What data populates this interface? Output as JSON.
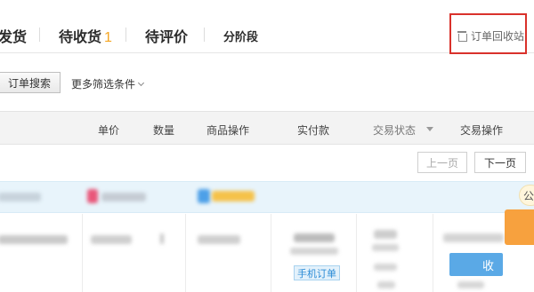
{
  "tabs": {
    "to_ship": "发货",
    "to_receive": "待收货",
    "to_receive_count": "1",
    "to_review": "待评价",
    "installment": "分阶段",
    "recycle_bin": "订单回收站"
  },
  "search": {
    "button_label": "订单搜索",
    "more_filters_label": "更多筛选条件"
  },
  "table": {
    "columns": {
      "unit_price": "单价",
      "quantity": "数量",
      "item_ops": "商品操作",
      "paid": "实付款",
      "trade_status": "交易状态",
      "trade_ops": "交易操作"
    }
  },
  "pager": {
    "prev": "上一页",
    "next": "下一页"
  },
  "order": {
    "side_badge": "公",
    "phone_tag": "手机订单",
    "receive_button": "收"
  },
  "colors": {
    "highlight_box": "#d9312b",
    "count_accent": "#f5a623",
    "order_head_bg": "#e8f4fb",
    "receive_button": "#5aa9e6"
  }
}
